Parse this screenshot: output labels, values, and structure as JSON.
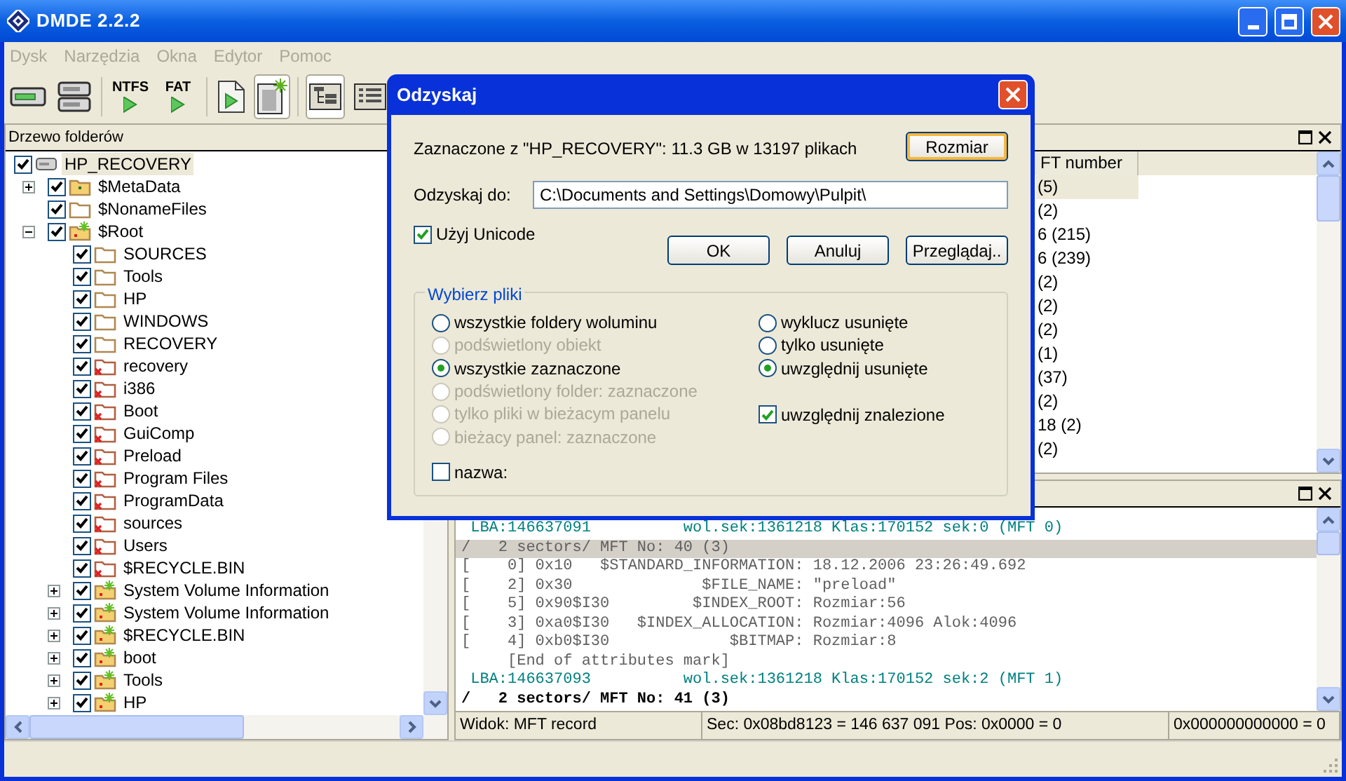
{
  "window": {
    "title": "DMDE 2.2.2"
  },
  "menu": [
    {
      "label": "Dysk",
      "disabled": true
    },
    {
      "label": "Narzędzia",
      "disabled": true
    },
    {
      "label": "Okna",
      "disabled": true
    },
    {
      "label": "Edytor",
      "disabled": true
    },
    {
      "label": "Pomoc",
      "disabled": true
    }
  ],
  "toolbar": [
    {
      "kind": "drive",
      "pressed": false
    },
    {
      "kind": "drives",
      "pressed": false
    },
    {
      "kind": "separator"
    },
    {
      "kind": "filesystem",
      "label": "NTFS",
      "pressed": false
    },
    {
      "kind": "filesystem",
      "label": "FAT",
      "pressed": false
    },
    {
      "kind": "separator"
    },
    {
      "kind": "file-play",
      "pressed": false
    },
    {
      "kind": "file-new",
      "pressed": true
    },
    {
      "kind": "separator"
    },
    {
      "kind": "tree-view",
      "pressed": true
    },
    {
      "kind": "list-view",
      "pressed": false
    }
  ],
  "folder_tree": {
    "title": "Drzewo folderów",
    "items": [
      {
        "label": "HP_RECOVERY",
        "kind": "drive",
        "checked": true,
        "selected": true,
        "children": [
          {
            "label": "$MetaData",
            "kind": "special",
            "checked": true,
            "selected": false,
            "expanded": false
          },
          {
            "label": "$NonameFiles",
            "kind": "folder",
            "checked": true,
            "selected": false
          },
          {
            "label": "$Root",
            "kind": "found",
            "checked": true,
            "selected": false,
            "expanded": true,
            "children": [
              {
                "label": "SOURCES",
                "kind": "folder",
                "checked": true,
                "selected": false
              },
              {
                "label": "Tools",
                "kind": "folder",
                "checked": true,
                "selected": false
              },
              {
                "label": "HP",
                "kind": "folder",
                "checked": true,
                "selected": false
              },
              {
                "label": "WINDOWS",
                "kind": "folder",
                "checked": true,
                "selected": false
              },
              {
                "label": "RECOVERY",
                "kind": "folder",
                "checked": true,
                "selected": false
              },
              {
                "label": "recovery",
                "kind": "deleted",
                "checked": true,
                "selected": false
              },
              {
                "label": "i386",
                "kind": "deleted",
                "checked": true,
                "selected": false
              },
              {
                "label": "Boot",
                "kind": "deleted",
                "checked": true,
                "selected": false
              },
              {
                "label": "GuiComp",
                "kind": "deleted",
                "checked": true,
                "selected": false
              },
              {
                "label": "Preload",
                "kind": "deleted",
                "checked": true,
                "selected": false
              },
              {
                "label": "Program Files",
                "kind": "deleted",
                "checked": true,
                "selected": false
              },
              {
                "label": "ProgramData",
                "kind": "deleted",
                "checked": true,
                "selected": false
              },
              {
                "label": "sources",
                "kind": "deleted",
                "checked": true,
                "selected": false
              },
              {
                "label": "Users",
                "kind": "deleted",
                "checked": true,
                "selected": false
              },
              {
                "label": "$RECYCLE.BIN",
                "kind": "deleted",
                "checked": true,
                "selected": false
              },
              {
                "label": "System Volume Information",
                "kind": "found",
                "checked": true,
                "selected": false,
                "expanded": false
              },
              {
                "label": "System Volume Information",
                "kind": "found",
                "checked": true,
                "selected": false,
                "expanded": false
              },
              {
                "label": "$RECYCLE.BIN",
                "kind": "found",
                "checked": true,
                "selected": false,
                "expanded": false
              },
              {
                "label": "boot",
                "kind": "found",
                "checked": true,
                "selected": false,
                "expanded": false
              },
              {
                "label": "Tools",
                "kind": "found",
                "checked": true,
                "selected": false,
                "expanded": false
              },
              {
                "label": "HP",
                "kind": "found",
                "checked": true,
                "selected": false,
                "expanded": false
              }
            ]
          }
        ]
      }
    ]
  },
  "file_panel": {
    "column": "FT number",
    "rows": [
      {
        "text": "(5)",
        "selected": true
      },
      {
        "text": "(2)",
        "selected": false
      },
      {
        "text": "6 (215)",
        "selected": false
      },
      {
        "text": "6 (239)",
        "selected": false
      },
      {
        "text": "(2)",
        "selected": false
      },
      {
        "text": "(2)",
        "selected": false
      },
      {
        "text": "(2)",
        "selected": false
      },
      {
        "text": "(1)",
        "selected": false
      },
      {
        "text": "(37)",
        "selected": false
      },
      {
        "text": "(2)",
        "selected": false
      },
      {
        "text": "18 (2)",
        "selected": false
      },
      {
        "text": "(2)",
        "selected": false
      }
    ]
  },
  "record_panel": {
    "lines": [
      {
        "kind": "lba",
        "text": " LBA:146637091          wol.sek:1361218 Klas:170152 sek:0 (MFT 0)",
        "selected": false
      },
      {
        "kind": "record",
        "text": "/   2 sectors/ MFT No: 40 (3)",
        "selected": true
      },
      {
        "kind": "attribute",
        "text": "[    0] 0x10   $STANDARD_INFORMATION: 18.12.2006 23:26:49.692",
        "selected": false
      },
      {
        "kind": "attribute",
        "text": "[    2] 0x30              $FILE_NAME: \"preload\"",
        "selected": false
      },
      {
        "kind": "attribute",
        "text": "[    5] 0x90$I30         $INDEX_ROOT: Rozmiar:56",
        "selected": false
      },
      {
        "kind": "attribute",
        "text": "[    3] 0xa0$I30   $INDEX_ALLOCATION: Rozmiar:4096 Alok:4096",
        "selected": false
      },
      {
        "kind": "attribute",
        "text": "[    4] 0xb0$I30             $BITMAP: Rozmiar:8",
        "selected": false
      },
      {
        "kind": "attribute",
        "text": "     [End of attributes mark]",
        "selected": false
      },
      {
        "kind": "lba",
        "text": " LBA:146637093          wol.sek:1361218 Klas:170152 sek:2 (MFT 1)",
        "selected": false
      },
      {
        "kind": "record",
        "text": "/   2 sectors/ MFT No: 41 (3)",
        "selected": false
      }
    ],
    "status": [
      "Widok: MFT record",
      "Sec: 0x08bd8123 = 146 637 091  Pos: 0x0000 = 0",
      "0x000000000000 = 0"
    ]
  },
  "dialog": {
    "title": "Odzyskaj",
    "summary": "Zaznaczone z \"HP_RECOVERY\": 11.3 GB w 13197 plikach",
    "size_button": {
      "label": "Rozmiar",
      "focused": true
    },
    "destination_label": "Odzyskaj do:",
    "destination": "C:\\Documents and Settings\\Domowy\\Pulpit\\",
    "unicode": {
      "label": "Użyj Unicode",
      "checked": true
    },
    "buttons": [
      "OK",
      "Anuluj",
      "Przeglądaj.."
    ],
    "group": {
      "title": "Wybierz pliki",
      "scope_options": [
        {
          "label": "wszystkie foldery woluminu",
          "selected": false,
          "disabled": false
        },
        {
          "label": "podświetlony obiekt",
          "selected": false,
          "disabled": true
        },
        {
          "label": "wszystkie zaznaczone",
          "selected": true,
          "disabled": false
        },
        {
          "label": "podświetlony folder: zaznaczone",
          "selected": false,
          "disabled": true
        },
        {
          "label": "tylko pliki w bieżacym panelu",
          "selected": false,
          "disabled": true
        },
        {
          "label": "bieżacy panel: zaznaczone",
          "selected": false,
          "disabled": true
        }
      ],
      "deleted_options": [
        {
          "label": "wyklucz usunięte",
          "selected": false
        },
        {
          "label": "tylko usunięte",
          "selected": false
        },
        {
          "label": "uwzględnij usunięte",
          "selected": true
        }
      ],
      "include_found": {
        "label": "uwzględnij znalezione",
        "checked": true
      },
      "name_filter": {
        "label": "nazwa:",
        "checked": false
      }
    }
  }
}
